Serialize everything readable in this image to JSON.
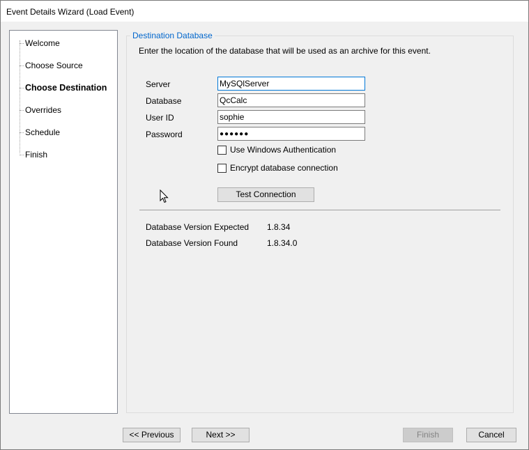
{
  "window": {
    "title": "Event Details Wizard (Load Event)"
  },
  "nav": {
    "items": [
      {
        "label": "Welcome",
        "active": false
      },
      {
        "label": "Choose Source",
        "active": false
      },
      {
        "label": "Choose Destination",
        "active": true
      },
      {
        "label": "Overrides",
        "active": false
      },
      {
        "label": "Schedule",
        "active": false
      },
      {
        "label": "Finish",
        "active": false
      }
    ]
  },
  "destination": {
    "group_title": "Destination Database",
    "intro": "Enter the location of the database that will be used as an archive for this event.",
    "server_label": "Server",
    "server_value": "MySQlServer",
    "database_label": "Database",
    "database_value": "QcCalc",
    "userid_label": "User ID",
    "userid_value": "sophie",
    "password_label": "Password",
    "password_value": "●●●●●●",
    "windows_auth_label": "Use Windows Authentication",
    "windows_auth_checked": false,
    "encrypt_label": "Encrypt database connection",
    "encrypt_checked": false,
    "test_button": "Test Connection",
    "version_expected_label": "Database Version Expected",
    "version_expected_value": "1.8.34",
    "version_found_label": "Database Version Found",
    "version_found_value": "1.8.34.0"
  },
  "buttons": {
    "previous": "<< Previous",
    "next": "Next >>",
    "finish": "Finish",
    "cancel": "Cancel"
  },
  "icons": {
    "cursor": "mouse-pointer-icon"
  }
}
